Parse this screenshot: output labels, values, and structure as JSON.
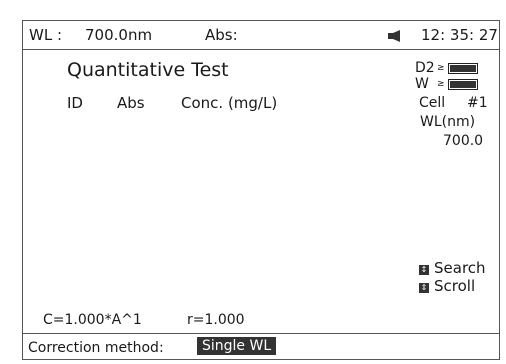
{
  "status_bar": {
    "wl_label": "WL :",
    "wl_value": "700.0nm",
    "abs_label": "Abs:",
    "time": "12: 35: 27"
  },
  "main": {
    "title": "Quantitative Test",
    "columns": [
      "ID",
      "Abs",
      "Conc. (mg/L)"
    ]
  },
  "side_panel": {
    "lamp_d2_label": "D2",
    "lamp_w_label": "W",
    "lamp_d2_level": 1.0,
    "lamp_w_level": 1.0,
    "cell_label": "Cell",
    "cell_value": "#1",
    "wl_label": "WL(nm)",
    "wl_value": "700.0",
    "search_label": "Search",
    "scroll_label": "Scroll"
  },
  "formula": {
    "equation": "C=1.000*A^1",
    "r_value": "r=1.000"
  },
  "bottom_bar": {
    "correction_label": "Correction method:",
    "correction_value": "Single WL"
  },
  "icons": {
    "speaker": "speaker-icon",
    "search_key": "up-down-key-icon",
    "scroll_key": "scroll-key-icon"
  }
}
